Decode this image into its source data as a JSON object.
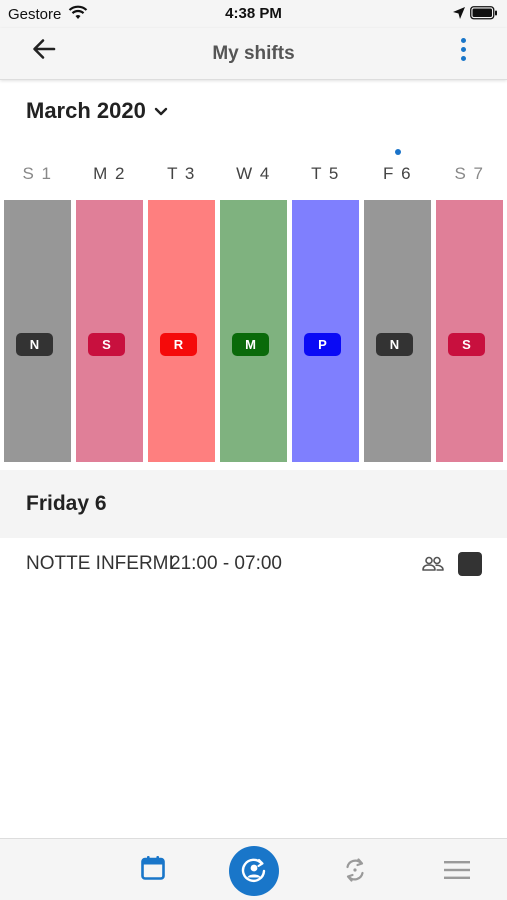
{
  "status_bar": {
    "carrier": "Gestore",
    "time": "4:38 PM"
  },
  "nav": {
    "title": "My shifts"
  },
  "calendar": {
    "month": "March 2020",
    "days": [
      {
        "label": "S 1",
        "shift_code": "N",
        "col_color": "#979797",
        "badge_color": "#333333",
        "weekend": true
      },
      {
        "label": "M 2",
        "shift_code": "S",
        "col_color": "#e07f98",
        "badge_color": "#c8103e",
        "weekend": false
      },
      {
        "label": "T 3",
        "shift_code": "R",
        "col_color": "#fe7f7f",
        "badge_color": "#f50a0a",
        "weekend": false
      },
      {
        "label": "W 4",
        "shift_code": "M",
        "col_color": "#7fb27f",
        "badge_color": "#0a6a0a",
        "weekend": false
      },
      {
        "label": "T 5",
        "shift_code": "P",
        "col_color": "#7f7ffe",
        "badge_color": "#0a0af5",
        "weekend": false
      },
      {
        "label": "F 6",
        "shift_code": "N",
        "col_color": "#979797",
        "badge_color": "#333333",
        "weekend": false
      },
      {
        "label": "S 7",
        "shift_code": "S",
        "col_color": "#e07f98",
        "badge_color": "#c8103e",
        "weekend": true
      }
    ],
    "today_index": 5
  },
  "selected_day": {
    "title": "Friday 6",
    "shift": {
      "name": "NOTTE INFERMI",
      "time": "21:00 - 07:00",
      "color": "#333333"
    }
  },
  "tab_bar": {
    "active_color": "#1976c9",
    "icons": [
      "calendar-icon",
      "home-user-icon",
      "swap-icon",
      "menu-icon"
    ]
  }
}
